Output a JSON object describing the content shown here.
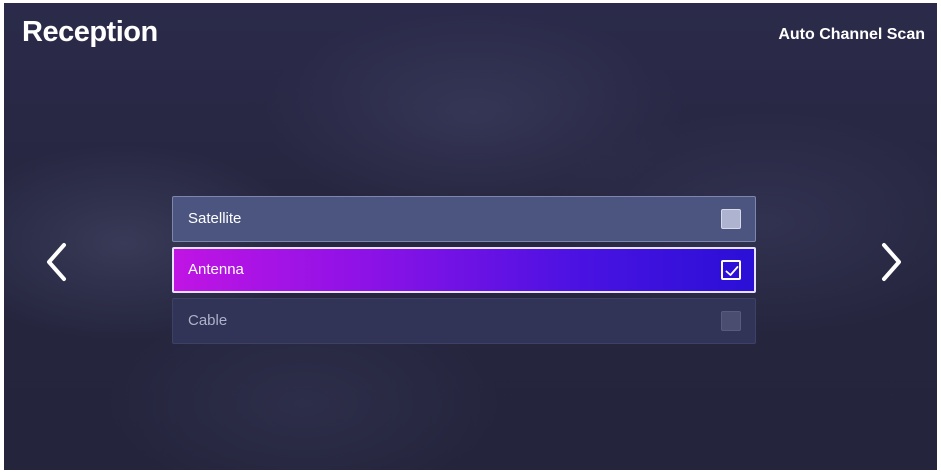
{
  "header": {
    "title": "Reception",
    "action_label": "Auto Channel Scan"
  },
  "navigation": {
    "prev_icon": "chevron-left-icon",
    "next_icon": "chevron-right-icon"
  },
  "options": [
    {
      "label": "Satellite",
      "checked": false,
      "state": "default"
    },
    {
      "label": "Antenna",
      "checked": true,
      "state": "focused"
    },
    {
      "label": "Cable",
      "checked": false,
      "state": "dimmed"
    }
  ],
  "colors": {
    "background": "#262640",
    "focus_gradient_start": "#c014e4",
    "focus_gradient_end": "#2a10d6",
    "text": "#ffffff"
  }
}
